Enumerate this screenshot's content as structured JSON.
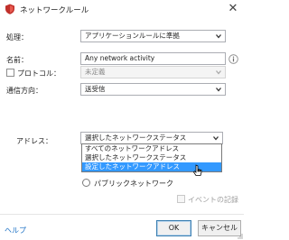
{
  "window": {
    "title": "ネットワークルール",
    "close_label": "✕"
  },
  "form": {
    "action_label": "処理：",
    "action_value": "アプリケーションルールに準拠",
    "name_label": "名前：",
    "name_value": "Any network activity",
    "protocol_label": "プロトコル：",
    "protocol_value": "未定義",
    "direction_label": "通信方向：",
    "direction_value": "送受信",
    "address_label": "アドレス：",
    "address_value": "選択したネットワークステータス"
  },
  "dropdown": {
    "options": [
      "すべてのネットワークアドレス",
      "選択したネットワークステータス",
      "設定したネットワークアドレス"
    ],
    "highlighted_index": 2
  },
  "options": {
    "public_network_label": "パブリックネットワーク",
    "log_events_label": "イベントの記録"
  },
  "footer": {
    "help_label": "ヘルプ",
    "ok_label": "OK",
    "cancel_label": "キャンセル"
  },
  "colors": {
    "selection": "#3399ff",
    "help_link": "#1a70c4"
  }
}
